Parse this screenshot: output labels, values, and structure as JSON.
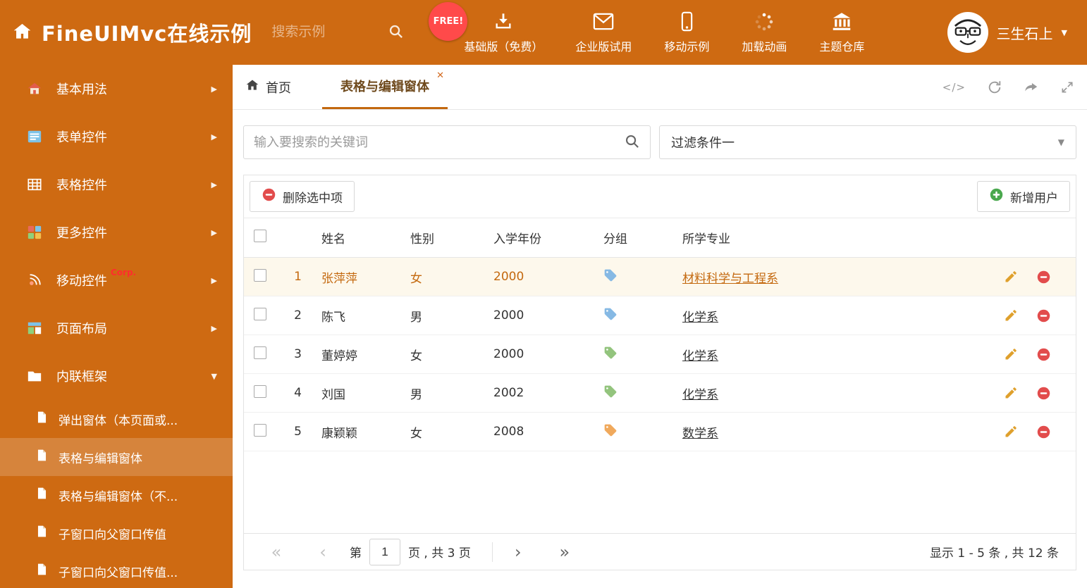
{
  "header": {
    "title": "FineUIMvc在线示例",
    "search_placeholder": "搜索示例",
    "free_badge": "FREE!",
    "nav": [
      {
        "label": "基础版（免费）"
      },
      {
        "label": "企业版试用"
      },
      {
        "label": "移动示例"
      },
      {
        "label": "加载动画"
      },
      {
        "label": "主题仓库"
      }
    ],
    "user_name": "三生石上"
  },
  "sidebar": {
    "items": [
      {
        "label": "基本用法"
      },
      {
        "label": "表单控件"
      },
      {
        "label": "表格控件"
      },
      {
        "label": "更多控件"
      },
      {
        "label": "移动控件",
        "badge": "Corp."
      },
      {
        "label": "页面布局"
      },
      {
        "label": "内联框架"
      }
    ],
    "subitems": [
      {
        "label": "弹出窗体（本页面或..."
      },
      {
        "label": "表格与编辑窗体"
      },
      {
        "label": "表格与编辑窗体（不..."
      },
      {
        "label": "子窗口向父窗口传值"
      },
      {
        "label": "子窗口向父窗口传值..."
      }
    ]
  },
  "tabs": {
    "home_label": "首页",
    "active_label": "表格与编辑窗体"
  },
  "filter_bar": {
    "search_placeholder": "输入要搜索的关键词",
    "filter_value": "过滤条件一"
  },
  "toolbar": {
    "delete_label": "删除选中项",
    "add_label": "新增用户"
  },
  "table": {
    "headers": {
      "name": "姓名",
      "gender": "性别",
      "year": "入学年份",
      "group": "分组",
      "major": "所学专业"
    },
    "rows": [
      {
        "num": "1",
        "name": "张萍萍",
        "gender": "女",
        "year": "2000",
        "tag_color": "#86b9e4",
        "major": "材料科学与工程系",
        "selected": true
      },
      {
        "num": "2",
        "name": "陈飞",
        "gender": "男",
        "year": "2000",
        "tag_color": "#86b9e4",
        "major": "化学系",
        "selected": false
      },
      {
        "num": "3",
        "name": "董婷婷",
        "gender": "女",
        "year": "2000",
        "tag_color": "#93c47d",
        "major": "化学系",
        "selected": false
      },
      {
        "num": "4",
        "name": "刘国",
        "gender": "男",
        "year": "2002",
        "tag_color": "#93c47d",
        "major": "化学系",
        "selected": false
      },
      {
        "num": "5",
        "name": "康颖颖",
        "gender": "女",
        "year": "2008",
        "tag_color": "#f0a95c",
        "major": "数学系",
        "selected": false
      }
    ]
  },
  "pagination": {
    "page_label": "第",
    "current_page": "1",
    "total_label": "页 , 共 3 页",
    "summary": "显示 1 - 5 条 , 共 12 条"
  },
  "icons": {
    "close": "✕",
    "caret_down": "▼",
    "chevron_right": "▶",
    "code": "</>",
    "first": "«",
    "prev": "‹",
    "next": "›",
    "last": "»"
  },
  "colors": {
    "header_bg": "#ce6a12",
    "accent": "#c4690f",
    "selected_row_bg": "#fdf8ec"
  }
}
